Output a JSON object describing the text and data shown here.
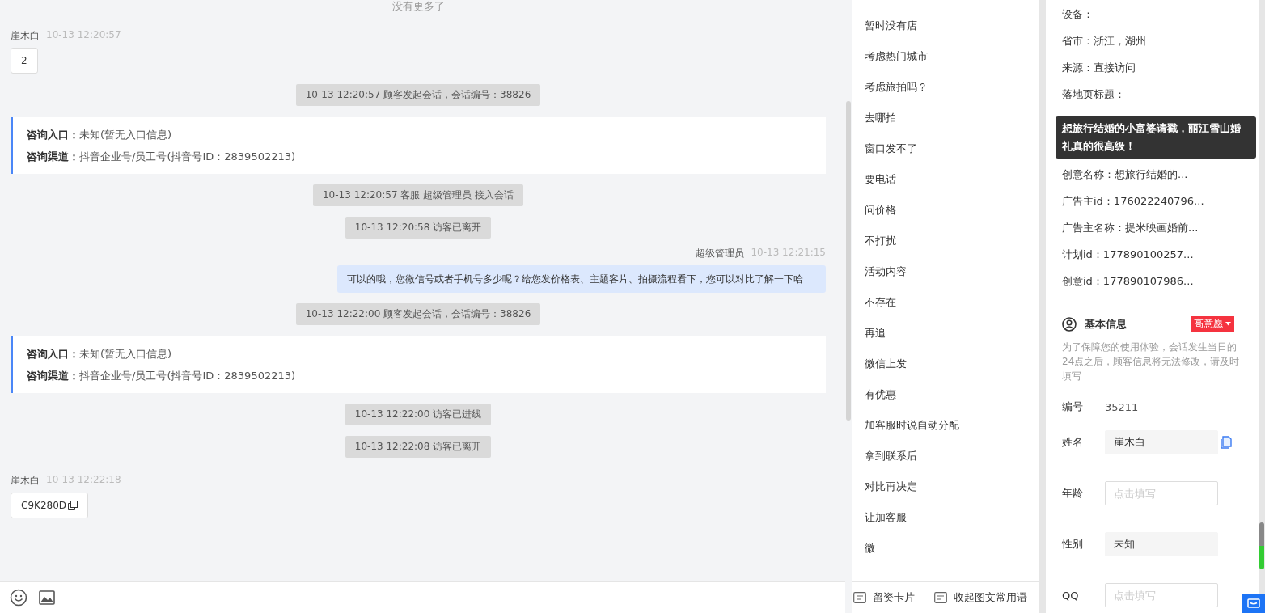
{
  "chat": {
    "top_notice": "没有更多了",
    "messages": [
      {
        "kind": "visitor",
        "sender": "崖木白",
        "time": "10-13 12:20:57",
        "text": "2",
        "copyable": false
      },
      {
        "kind": "system",
        "text": "10-13 12:20:57 顾客发起会话，会话编号：38826"
      },
      {
        "kind": "source",
        "lines": [
          {
            "label": "咨询入口：",
            "value": "未知(暂无入口信息)"
          },
          {
            "label": "咨询渠道：",
            "value": "抖音企业号/员工号(抖音号ID：2839502213)"
          }
        ]
      },
      {
        "kind": "system",
        "text": "10-13 12:20:57 客服 超级管理员 接入会话"
      },
      {
        "kind": "system",
        "text": "10-13 12:20:58 访客已离开"
      },
      {
        "kind": "agent",
        "sender": "超级管理员",
        "time": "10-13 12:21:15",
        "text": "可以的哦，您微信号或者手机号多少呢？给您发价格表、主题客片、拍摄流程看下，您可以对比了解一下哈"
      },
      {
        "kind": "system",
        "text": "10-13 12:22:00 顾客发起会话，会话编号：38826"
      },
      {
        "kind": "source",
        "lines": [
          {
            "label": "咨询入口：",
            "value": "未知(暂无入口信息)"
          },
          {
            "label": "咨询渠道：",
            "value": "抖音企业号/员工号(抖音号ID：2839502213)"
          }
        ]
      },
      {
        "kind": "system",
        "text": "10-13 12:22:00 访客已进线"
      },
      {
        "kind": "system",
        "text": "10-13 12:22:08 访客已离开"
      },
      {
        "kind": "visitor",
        "sender": "崖木白",
        "time": "10-13 12:22:18",
        "text": "C9K280D",
        "copyable": true
      }
    ]
  },
  "quick_replies": {
    "items": [
      "暂时没有店",
      "考虑热门城市",
      "考虑旅拍吗？",
      "去哪拍",
      "窗口发不了",
      "要电话",
      "问价格",
      "不打扰",
      "活动内容",
      "不存在",
      "再追",
      "微信上发",
      "有优惠",
      "加客服时说自动分配",
      "拿到联系后",
      "对比再决定",
      "让加客服",
      "微"
    ],
    "footer": [
      "留资卡片",
      "收起图文常用语"
    ]
  },
  "visitor_info": {
    "rows_top": [
      "设备：--",
      "省市：浙江，湖州",
      "来源：直接访问",
      "落地页标题：--"
    ],
    "tooltip": "想旅行结婚的小富婆请戳，丽江雪山婚礼真的很高级！",
    "rows_bottom": [
      "创意名称：想旅行结婚的...",
      "广告主id：176022240796...",
      "广告主名称：提米映画婚前...",
      "计划id：177890100257...",
      "创意id：177890107986..."
    ]
  },
  "basic_info": {
    "title": "基本信息",
    "intent_tag": "高意愿",
    "notice": "为了保障您的使用体验，会话发生当日的24点之后，顾客信息将无法修改，请及时填写",
    "fields": [
      {
        "kind": "text",
        "label": "编号",
        "value": "35211"
      },
      {
        "kind": "input",
        "label": "姓名",
        "value": "崖木白",
        "copy": true
      },
      {
        "kind": "input",
        "label": "年龄",
        "placeholder": "点击填写",
        "copy": false
      },
      {
        "kind": "input",
        "label": "性别",
        "value": "未知",
        "copy": false
      },
      {
        "kind": "input",
        "label": "QQ",
        "placeholder": "点击填写",
        "copy": false
      }
    ]
  }
}
